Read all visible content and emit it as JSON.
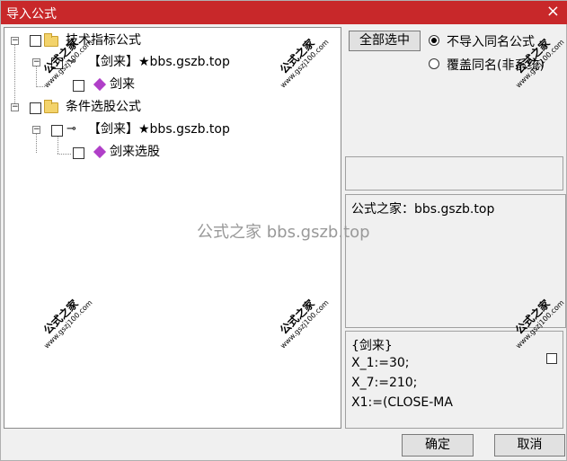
{
  "window": {
    "title": "导入公式",
    "close_icon": "×"
  },
  "tree": {
    "nodes": [
      {
        "label": "技术指标公式",
        "type": "folder"
      },
      {
        "label": "【剑来】★bbs.gszb.top",
        "type": "key"
      },
      {
        "label": "剑来",
        "type": "formula"
      },
      {
        "label": "条件选股公式",
        "type": "folder"
      },
      {
        "label": "【剑来】★bbs.gszb.top",
        "type": "key"
      },
      {
        "label": "剑来选股",
        "type": "formula"
      }
    ],
    "expand_minus": "−",
    "key_icon": "⊸"
  },
  "options": {
    "select_all_label": "全部选中",
    "radio_no_import": "不导入同名公式",
    "radio_overwrite": "覆盖同名(非系统)",
    "selected": "no_import"
  },
  "info": {
    "text": "公式之家：bbs.gszb.top"
  },
  "code": {
    "lines": [
      "{剑来}",
      "X_1:=30;",
      "X_7:=210;",
      "X1:=(CLOSE-MA"
    ]
  },
  "buttons": {
    "ok": "确定",
    "cancel": "取消"
  },
  "watermark": {
    "brand": "公式之家",
    "url": "www.gszj100.com",
    "center": "公式之家 bbs.gszb.top"
  }
}
